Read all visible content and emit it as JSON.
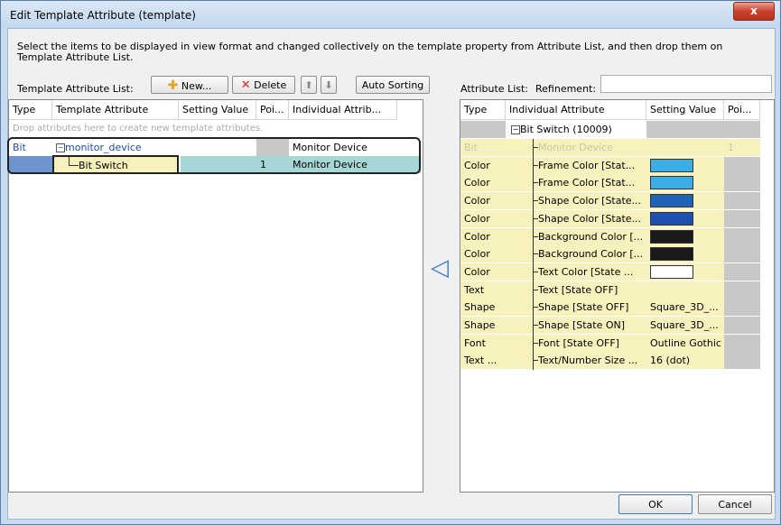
{
  "window": {
    "title": "Edit Template Attribute (template)",
    "close_glyph": "x"
  },
  "description": "Select the items to be displayed in view format and changed collectively on the template property from Attribute List, and then drop them on Template Attribute List.",
  "left": {
    "label": "Template Attribute List:",
    "buttons": {
      "new": "New...",
      "delete": "Delete",
      "up": "⬆",
      "down": "⬇",
      "auto_sorting": "Auto Sorting"
    },
    "headers": [
      "Type",
      "Template Attribute",
      "Setting Value",
      "Poi...",
      "Individual Attrib..."
    ],
    "drop_hint": "Drop attributes here to create new template attributes.",
    "rows": [
      {
        "type": "Bit",
        "attribute": "monitor_device",
        "setting": "",
        "point": "",
        "individual": "Monitor Device"
      },
      {
        "type": "",
        "attribute": "Bit Switch",
        "setting": "",
        "point": "1",
        "individual": "Monitor Device"
      }
    ]
  },
  "right": {
    "label": "Attribute List:",
    "refinement_label": "Refinement:",
    "refinement_value": "",
    "headers": [
      "Type",
      "Individual Attribute",
      "Setting Value",
      "Poi..."
    ],
    "root": "Bit Switch (10009)",
    "rows": [
      {
        "type": "Bit",
        "attr": "Monitor Device",
        "value": "",
        "point": "1",
        "disabled": true
      },
      {
        "type": "Color",
        "attr": "Frame Color [Stat...",
        "swatch": "#3aaee4"
      },
      {
        "type": "Color",
        "attr": "Frame Color [Stat...",
        "swatch": "#3aaee4"
      },
      {
        "type": "Color",
        "attr": "Shape Color [State...",
        "swatch": "#1f63b8"
      },
      {
        "type": "Color",
        "attr": "Shape Color [State...",
        "swatch": "#1f4fb0"
      },
      {
        "type": "Color",
        "attr": "Background Color [...",
        "swatch": "#1a1a1a"
      },
      {
        "type": "Color",
        "attr": "Background Color [...",
        "swatch": "#1a1a1a"
      },
      {
        "type": "Color",
        "attr": "Text Color [State ...",
        "swatch": "#ffffff"
      },
      {
        "type": "Text",
        "attr": "Text [State OFF]",
        "value": ""
      },
      {
        "type": "Shape",
        "attr": "Shape [State OFF]",
        "value": "Square_3D_..."
      },
      {
        "type": "Shape",
        "attr": "Shape [State ON]",
        "value": "Square_3D_..."
      },
      {
        "type": "Font",
        "attr": "Font [State OFF]",
        "value": "Outline Gothic"
      },
      {
        "type": "Text ...",
        "attr": "Text/Number Size ...",
        "value": "16 (dot)"
      }
    ]
  },
  "arrow_glyph": "◁",
  "footer": {
    "ok": "OK",
    "cancel": "Cancel"
  }
}
